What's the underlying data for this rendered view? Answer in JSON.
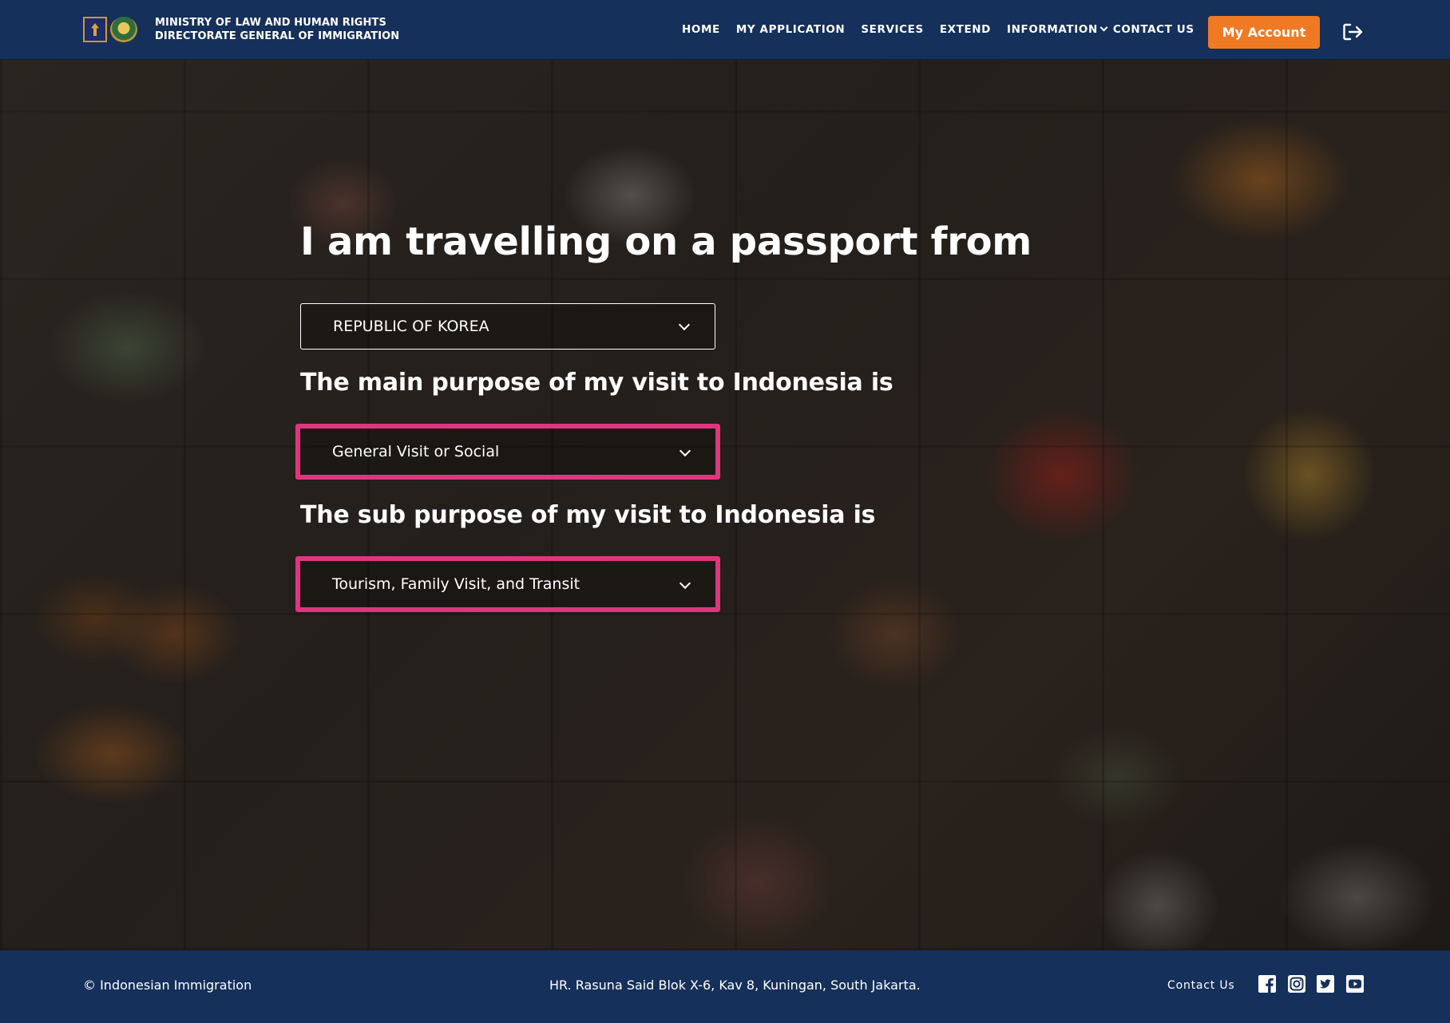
{
  "header": {
    "brand_line1": "MINISTRY OF  LAW  AND HUMAN RIGHTS",
    "brand_line2": "DIRECTORATE GENERAL OF IMMIGRATION",
    "nav": [
      {
        "label": "HOME"
      },
      {
        "label": "MY APPLICATION"
      },
      {
        "label": "SERVICES"
      },
      {
        "label": "EXTEND"
      },
      {
        "label": "INFORMATION"
      },
      {
        "label": "CONTACT US"
      }
    ],
    "account_button": "My Account",
    "accent_color": "#f07a23"
  },
  "main": {
    "title": "I am travelling on a passport from",
    "passport_select": {
      "value": "REPUBLIC OF KOREA"
    },
    "main_purpose_label": "The main purpose of my visit to Indonesia is",
    "main_purpose_select": {
      "value": "General Visit or Social"
    },
    "sub_purpose_label": "The sub purpose of my visit to Indonesia is",
    "sub_purpose_select": {
      "value": "Tourism, Family Visit, and Transit"
    },
    "highlight_color": "#e0357e"
  },
  "footer": {
    "copyright": "© Indonesian Immigration",
    "address": "HR. Rasuna Said Blok X-6, Kav 8, Kuningan, South Jakarta.",
    "contact": "Contact Us",
    "social_icons": [
      "facebook-icon",
      "instagram-icon",
      "twitter-icon",
      "youtube-icon"
    ]
  }
}
